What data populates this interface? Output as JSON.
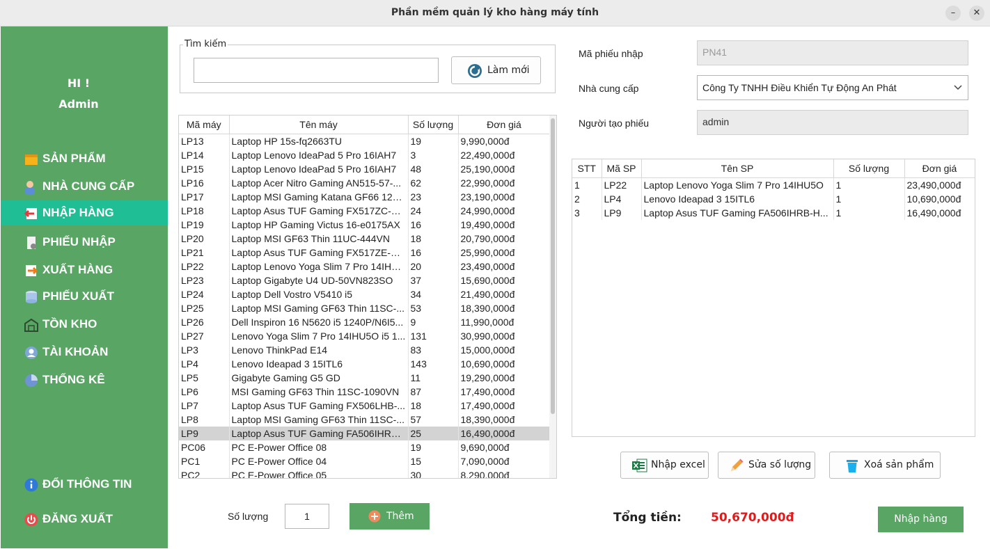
{
  "window": {
    "title": "Phần mềm quản lý kho hàng máy tính",
    "minimize": "–",
    "close": "✕"
  },
  "sidebar": {
    "greeting": "HI !",
    "user": "Admin",
    "items": [
      {
        "label": "SẢN PHẨM",
        "icon": "box-icon"
      },
      {
        "label": "NHÀ CUNG CẤP",
        "icon": "supplier-icon"
      },
      {
        "label": "NHẬP HÀNG",
        "icon": "import-icon"
      },
      {
        "label": "PHIẾU NHẬP",
        "icon": "import-receipt-icon"
      },
      {
        "label": "XUẤT HÀNG",
        "icon": "export-icon"
      },
      {
        "label": "PHIẾU XUẤT",
        "icon": "export-receipt-icon"
      },
      {
        "label": "TỒN KHO",
        "icon": "warehouse-icon"
      },
      {
        "label": "TÀI KHOẢN",
        "icon": "account-icon"
      },
      {
        "label": "THỐNG KÊ",
        "icon": "statistics-icon"
      }
    ],
    "info_label": "ĐỔI THÔNG TIN",
    "logout_label": "ĐĂNG XUẤT",
    "active_color": "#1fbe95",
    "bg_color": "#58a564"
  },
  "search": {
    "legend": "Tìm kiếm",
    "value": "",
    "refresh_label": "Làm mới"
  },
  "products": {
    "headers": [
      "Mã máy",
      "Tên máy",
      "Số lượng",
      "Đơn giá"
    ],
    "rows": [
      [
        "LP13",
        "Laptop HP 15s-fq2663TU",
        "19",
        "9,990,000đ"
      ],
      [
        "LP14",
        "Laptop Lenovo IdeaPad 5 Pro 16IAH7",
        "3",
        "22,490,000đ"
      ],
      [
        "LP15",
        "Laptop Lenovo IdeaPad 5 Pro 16IAH7",
        "48",
        "25,190,000đ"
      ],
      [
        "LP16",
        "Laptop Acer Nitro Gaming AN515-57-...",
        "62",
        "22,990,000đ"
      ],
      [
        "LP17",
        "Laptop MSI Gaming Katana GF66 12U...",
        "23",
        "23,190,000đ"
      ],
      [
        "LP18",
        "Laptop Asus TUF Gaming FX517ZC-H...",
        "24",
        "24,990,000đ"
      ],
      [
        "LP19",
        "Laptop HP Gaming Victus 16-e0175AX",
        "16",
        "19,490,000đ"
      ],
      [
        "LP20",
        "Laptop MSI GF63 Thin 11UC-444VN",
        "18",
        "20,790,000đ"
      ],
      [
        "LP21",
        "Laptop Asus TUF Gaming FX517ZE-H...",
        "16",
        "25,990,000đ"
      ],
      [
        "LP22",
        "Laptop Lenovo Yoga Slim 7 Pro 14IHU...",
        "20",
        "23,490,000đ"
      ],
      [
        "LP23",
        "Laptop Gigabyte U4 UD-50VN823SO",
        "37",
        "15,690,000đ"
      ],
      [
        "LP24",
        "Laptop Dell Vostro V5410 i5",
        "34",
        "21,490,000đ"
      ],
      [
        "LP25",
        "Laptop MSI Gaming GF63 Thin 11SC-...",
        "53",
        "18,390,000đ"
      ],
      [
        "LP26",
        "Dell Inspiron 16 N5620 i5 1240P/N6I5...",
        "9",
        "11,990,000đ"
      ],
      [
        "LP27",
        "Lenovo Yoga Slim 7 Pro 14IHU5O i5 1...",
        "131",
        "30,990,000đ"
      ],
      [
        "LP3",
        "Lenovo ThinkPad E14",
        "83",
        "15,000,000đ"
      ],
      [
        "LP4",
        "Lenovo Ideapad 3 15ITL6",
        "143",
        "10,690,000đ"
      ],
      [
        "LP5",
        "Gigabyte Gaming G5 GD",
        "11",
        "19,290,000đ"
      ],
      [
        "LP6",
        "MSI Gaming GF63 Thin 11SC-1090VN",
        "87",
        "17,490,000đ"
      ],
      [
        "LP7",
        "Laptop Asus TUF Gaming FX506LHB-...",
        "18",
        "17,490,000đ"
      ],
      [
        "LP8",
        "Laptop MSI Gaming GF63 Thin 11SC-...",
        "57",
        "18,390,000đ"
      ],
      [
        "LP9",
        "Laptop Asus TUF Gaming FA506IHRB...",
        "25",
        "16,490,000đ"
      ],
      [
        "PC06",
        "PC E-Power Office 08",
        "19",
        "9,690,000đ"
      ],
      [
        "PC1",
        "PC E-Power Office 04",
        "15",
        "7,090,000đ"
      ],
      [
        "PC2",
        "PC E-Power Office 05",
        "30",
        "8,290,000đ"
      ]
    ],
    "selected_index": 21
  },
  "quantity": {
    "label": "Số lượng",
    "value": "1",
    "add_label": "Thêm"
  },
  "form": {
    "receipt_id_label": "Mã phiếu nhập",
    "receipt_id": "PN41",
    "supplier_label": "Nhà cung cấp",
    "supplier": "Công Ty TNHH Điều Khiển Tự Động An Phát",
    "creator_label": "Người tạo phiếu",
    "creator": "admin"
  },
  "cart": {
    "headers": [
      "STT",
      "Mã SP",
      "Tên SP",
      "Số lượng",
      "Đơn giá"
    ],
    "rows": [
      [
        "1",
        "LP22",
        "Laptop Lenovo Yoga Slim 7 Pro 14IHU5O",
        "1",
        "23,490,000đ"
      ],
      [
        "2",
        "LP4",
        "Lenovo Ideapad 3 15ITL6",
        "1",
        "10,690,000đ"
      ],
      [
        "3",
        "LP9",
        "Laptop Asus TUF Gaming FA506IHRB-H...",
        "1",
        "16,490,000đ"
      ]
    ]
  },
  "actions": {
    "excel_label": "Nhập excel",
    "edit_label": "Sửa số lượng",
    "delete_label": "Xoá sản phẩm"
  },
  "total": {
    "label": "Tổng tiền:",
    "value": "50,670,000đ",
    "color": "#e01b1b"
  },
  "submit_label": "Nhập hàng"
}
